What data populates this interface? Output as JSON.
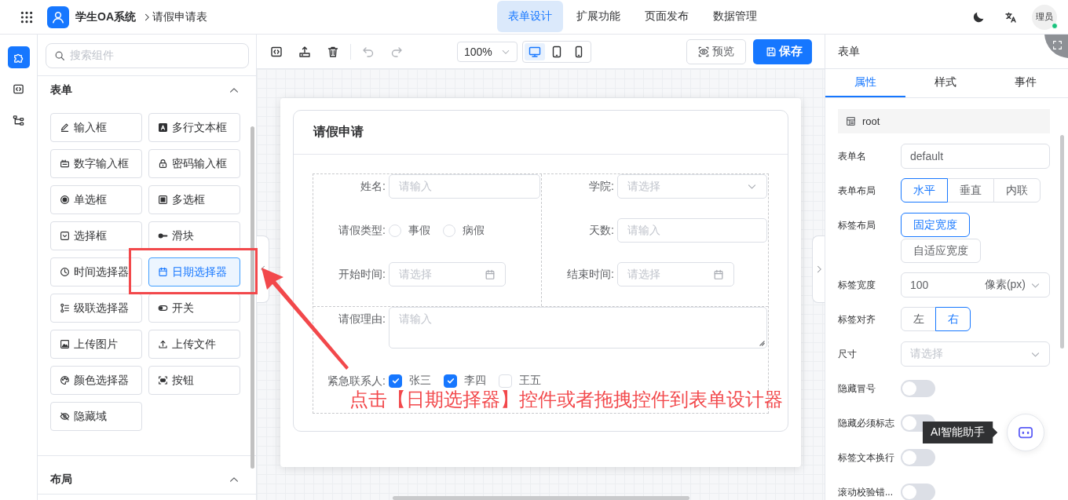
{
  "topbar": {
    "title": "学生OA系统",
    "breadcrumb": "请假申请表",
    "avatar": "理员",
    "online": true,
    "nav": [
      {
        "label": "表单设计",
        "selected": true
      },
      {
        "label": "扩展功能",
        "selected": false
      },
      {
        "label": "页面发布",
        "selected": false
      },
      {
        "label": "数据管理",
        "selected": false
      }
    ]
  },
  "rail": [
    {
      "kind": "components",
      "selected": true
    },
    {
      "kind": "code",
      "selected": false
    },
    {
      "kind": "tree",
      "selected": false
    }
  ],
  "search": {
    "placeholder": "搜索组件"
  },
  "groups": [
    {
      "title": "表单",
      "expanded": true,
      "items": [
        {
          "label": "输入框",
          "kind": "input",
          "selected": false
        },
        {
          "label": "多行文本框",
          "kind": "textarea",
          "selected": false
        },
        {
          "label": "数字输入框",
          "kind": "number",
          "selected": false
        },
        {
          "label": "密码输入框",
          "kind": "password",
          "selected": false
        },
        {
          "label": "单选框",
          "kind": "radio",
          "selected": false
        },
        {
          "label": "多选框",
          "kind": "checkbox",
          "selected": false
        },
        {
          "label": "选择框",
          "kind": "select",
          "selected": false
        },
        {
          "label": "滑块",
          "kind": "slider",
          "selected": false
        },
        {
          "label": "时间选择器",
          "kind": "time",
          "selected": false
        },
        {
          "label": "日期选择器",
          "kind": "date",
          "selected": true
        },
        {
          "label": "级联选择器",
          "kind": "cascader",
          "selected": false
        },
        {
          "label": "开关",
          "kind": "switch",
          "selected": false
        },
        {
          "label": "上传图片",
          "kind": "image",
          "selected": false
        },
        {
          "label": "上传文件",
          "kind": "file",
          "selected": false
        },
        {
          "label": "颜色选择器",
          "kind": "color",
          "selected": false
        },
        {
          "label": "按钮",
          "kind": "button",
          "selected": false
        },
        {
          "label": "隐藏域",
          "kind": "hidden",
          "selected": false
        }
      ]
    },
    {
      "title": "布局",
      "expanded": true
    }
  ],
  "toolbar": {
    "zoom": "100%",
    "preview": "预览",
    "save": "保存",
    "devices": [
      {
        "kind": "desktop",
        "selected": true
      },
      {
        "kind": "tablet",
        "selected": false
      },
      {
        "kind": "phone",
        "selected": false
      }
    ]
  },
  "form": {
    "title": "请假申请",
    "columns": [
      [
        {
          "label": "姓名:",
          "kind": "input",
          "placeholder": "请输入"
        },
        {
          "label": "请假类型:",
          "kind": "radio",
          "options": [
            {
              "label": "事假",
              "checked": false
            },
            {
              "label": "病假",
              "checked": false
            }
          ]
        },
        {
          "label": "开始时间:",
          "kind": "date",
          "placeholder": "请选择"
        }
      ],
      [
        {
          "label": "学院:",
          "kind": "select",
          "placeholder": "请选择"
        },
        {
          "label": "天数:",
          "kind": "input",
          "placeholder": "请输入"
        },
        {
          "label": "结束时间:",
          "kind": "date",
          "placeholder": "请选择"
        }
      ]
    ],
    "rows": [
      {
        "label": "请假理由:",
        "kind": "textarea",
        "placeholder": "请输入"
      },
      {
        "label": "紧急联系人:",
        "kind": "checkbox",
        "options": [
          {
            "label": "张三",
            "checked": true
          },
          {
            "label": "李四",
            "checked": true
          },
          {
            "label": "王五",
            "checked": false
          }
        ]
      }
    ]
  },
  "annotation": {
    "text": "点击【日期选择器】控件或者拖拽控件到表单设计器"
  },
  "props": {
    "title": "表单",
    "node": "root",
    "tabs": [
      {
        "label": "属性",
        "selected": true
      },
      {
        "label": "样式",
        "selected": false
      },
      {
        "label": "事件",
        "selected": false
      }
    ],
    "rows": [
      {
        "label": "表单名",
        "kind": "text",
        "value": "default"
      },
      {
        "label": "表单布局",
        "kind": "segmented",
        "options": [
          {
            "label": "水平",
            "selected": true
          },
          {
            "label": "垂直",
            "selected": false
          },
          {
            "label": "内联",
            "selected": false
          }
        ]
      },
      {
        "label": "标签布局",
        "kind": "stacked",
        "options": [
          {
            "label": "固定宽度",
            "selected": true
          },
          {
            "label": "自适应宽度",
            "selected": false
          }
        ]
      },
      {
        "label": "标签宽度",
        "kind": "unit",
        "value": "100",
        "unit": "像素(px)"
      },
      {
        "label": "标签对齐",
        "kind": "segmented",
        "options": [
          {
            "label": "左",
            "selected": false
          },
          {
            "label": "右",
            "selected": true
          }
        ]
      },
      {
        "label": "尺寸",
        "kind": "select",
        "placeholder": "请选择"
      },
      {
        "label": "隐藏冒号",
        "kind": "switch",
        "on": false
      },
      {
        "label": "隐藏必须标志",
        "kind": "switch",
        "on": false
      },
      {
        "label": "标签文本换行",
        "kind": "switch",
        "on": false
      },
      {
        "label": "滚动校验错...",
        "kind": "switch",
        "on": false
      }
    ]
  },
  "assistant": {
    "tooltip": "AI智能助手"
  }
}
